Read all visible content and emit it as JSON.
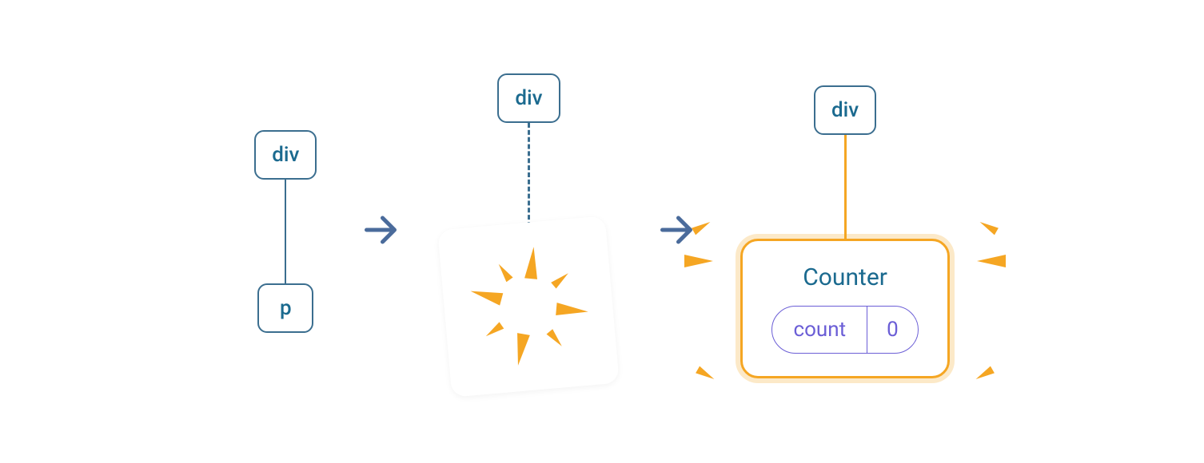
{
  "stage1": {
    "parent_label": "div",
    "child_label": "p"
  },
  "stage2": {
    "parent_label": "div"
  },
  "stage3": {
    "parent_label": "div",
    "component_name": "Counter",
    "state_key": "count",
    "state_value": "0"
  }
}
